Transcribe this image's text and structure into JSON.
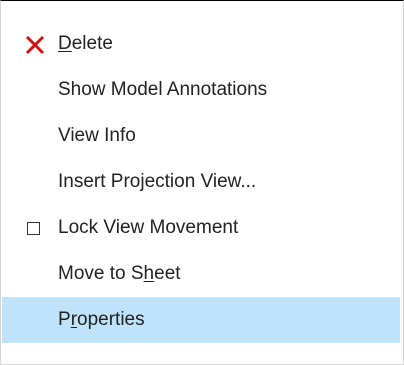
{
  "context_menu": {
    "items": [
      {
        "pre": "",
        "mnemonic": "D",
        "post": "elete",
        "icon": "delete-x-icon",
        "icon_color": "#cc1111",
        "highlighted": false
      },
      {
        "pre": "Show Model Annotations",
        "mnemonic": "",
        "post": "",
        "icon": "",
        "highlighted": false
      },
      {
        "pre": "View Info",
        "mnemonic": "",
        "post": "",
        "icon": "",
        "highlighted": false
      },
      {
        "pre": "Insert Projection View...",
        "mnemonic": "",
        "post": "",
        "icon": "",
        "highlighted": false
      },
      {
        "pre": "Lock View Movement",
        "mnemonic": "",
        "post": "",
        "icon": "checkbox-icon",
        "checked": false,
        "highlighted": false
      },
      {
        "pre": "Move to S",
        "mnemonic": "h",
        "post": "eet",
        "icon": "",
        "highlighted": false
      },
      {
        "pre": "P",
        "mnemonic": "r",
        "post": "operties",
        "icon": "",
        "highlighted": true
      }
    ],
    "highlight_color": "#bfe3fb"
  }
}
